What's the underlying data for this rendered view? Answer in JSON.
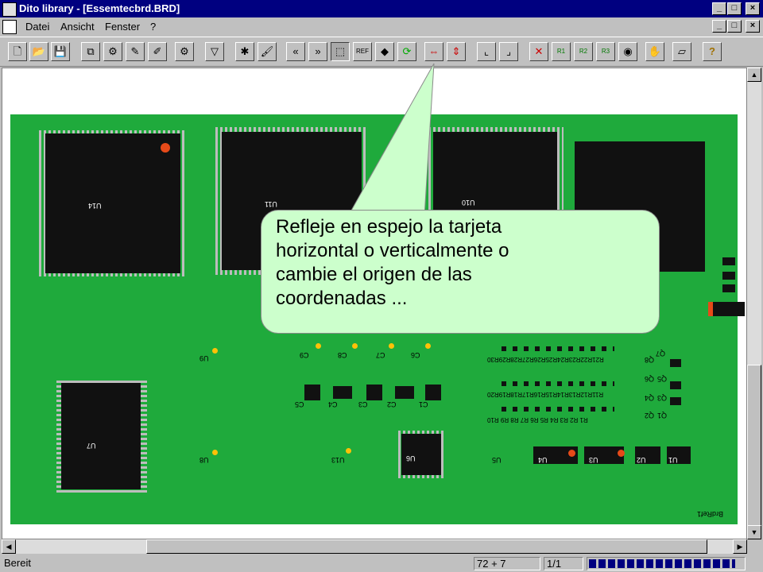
{
  "window": {
    "title": "Dito library - [Essemtecbrd.BRD]",
    "app_icon": "dito-app-icon",
    "controls": [
      "minimize",
      "maximize",
      "close"
    ]
  },
  "menu": {
    "items": [
      {
        "label": "Datei"
      },
      {
        "label": "Ansicht"
      },
      {
        "label": "Fenster"
      },
      {
        "label": "?"
      }
    ]
  },
  "toolbar": {
    "buttons": [
      {
        "name": "new-file-icon"
      },
      {
        "name": "open-folder-icon"
      },
      {
        "name": "save-icon"
      },
      {
        "name": "copy-library-icon"
      },
      {
        "name": "component-icon"
      },
      {
        "name": "edit-component-icon"
      },
      {
        "name": "edit-pad-icon"
      },
      {
        "name": "settings-icon"
      },
      {
        "name": "filter-icon"
      },
      {
        "name": "tools-icon"
      },
      {
        "name": "brush-icon"
      },
      {
        "name": "previous-icon"
      },
      {
        "name": "next-icon"
      },
      {
        "name": "select-area-icon"
      },
      {
        "name": "reference-icon",
        "label": "REF"
      },
      {
        "name": "chip-icon"
      },
      {
        "name": "rotate-icon"
      },
      {
        "name": "mirror-horizontal-icon"
      },
      {
        "name": "mirror-vertical-icon"
      },
      {
        "name": "origin-icon"
      },
      {
        "name": "origin-move-icon"
      },
      {
        "name": "delete-icon"
      },
      {
        "name": "ref1-icon",
        "label": "R1"
      },
      {
        "name": "ref2-icon",
        "label": "R2"
      },
      {
        "name": "ref3-icon",
        "label": "R3"
      },
      {
        "name": "view-icon"
      },
      {
        "name": "hand-icon"
      },
      {
        "name": "eraser-icon"
      },
      {
        "name": "edit-icon"
      },
      {
        "name": "help-icon"
      }
    ]
  },
  "board": {
    "color": "#1faa3c",
    "labels": {
      "u14": "U14",
      "u11": "U11",
      "u10": "U10",
      "u7": "U7",
      "u9": "U9",
      "u8": "U8",
      "u13": "U13",
      "u6": "U6",
      "u5": "U5",
      "u4": "U4",
      "u3": "U3",
      "u2": "U2",
      "u1": "U1",
      "c9": "C9",
      "c8": "C8",
      "c7": "C7",
      "c6": "C6",
      "c5": "C5",
      "c4": "C4",
      "c3": "C3",
      "c2": "C2",
      "c1": "C1",
      "r_row1": "R21R22R23R24R25R26R27R28R29R30",
      "r_row2": "R11R12R13R14R15R16R17R18R19R20",
      "r_row3": "R1 R2 R3 R4 R5 R6 R7 R8 R9 R10",
      "q_col": [
        "Q8",
        "Q7",
        "Q6",
        "Q5",
        "Q4",
        "Q3",
        "Q2",
        "Q1"
      ],
      "board_ref": "BrdRef1"
    }
  },
  "callout": {
    "lines": [
      "Refleje en espejo la tarjeta",
      "horizontal o verticalmente o",
      "cambie el origen de las",
      "coordenadas ..."
    ],
    "color": "#ccffcc"
  },
  "statusbar": {
    "status": "Bereit",
    "coords": "72 + 7",
    "page": "1/1",
    "progress": 0.95
  },
  "colors": {
    "titlebar": "#000080",
    "pcb": "#1faa3c",
    "chip": "#111111",
    "pad_red": "#e64a19",
    "pad_yellow": "#ffc107"
  }
}
